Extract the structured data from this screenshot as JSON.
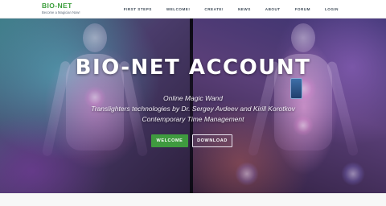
{
  "brand": {
    "title": "BIO-NET",
    "subtitle": "Become a Magician Now!"
  },
  "nav": {
    "items": [
      {
        "label": "FIRST STEPS"
      },
      {
        "label": "WELCOME!"
      },
      {
        "label": "CREATE!"
      },
      {
        "label": "NEWS"
      },
      {
        "label": "ABOUT"
      },
      {
        "label": "FORUM"
      },
      {
        "label": "LOGIN"
      }
    ]
  },
  "hero": {
    "title": "BIO-NET ACCOUNT",
    "lines": [
      "Online Magic Wand",
      "Translighters technologies by Dr. Sergey Avdeev and Kirill Korotkov",
      "Contemporary Time Management"
    ],
    "buttons": {
      "welcome": "WELCOME",
      "download": "DOWNLOAD"
    }
  },
  "colors": {
    "brand_green": "#3b9e3b",
    "button_green": "#3f9a3f",
    "nav_text": "#3d4a57"
  }
}
